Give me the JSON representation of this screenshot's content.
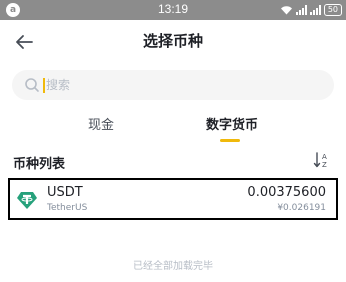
{
  "status_bar": {
    "time": "13:19",
    "notification_badge": "a",
    "battery": "50"
  },
  "header": {
    "title": "选择币种"
  },
  "search": {
    "placeholder": "搜索",
    "value": ""
  },
  "tabs": [
    {
      "label": "现金",
      "active": false
    },
    {
      "label": "数字货币",
      "active": true
    }
  ],
  "section": {
    "title": "币种列表"
  },
  "coins": [
    {
      "symbol": "USDT",
      "name": "TetherUS",
      "amount": "0.00375600",
      "fiat_value": "¥0.026191"
    }
  ],
  "footer_note": "已经全部加载完毕",
  "colors": {
    "accent": "#f0b90b",
    "tether": "#26a17b",
    "status_bar": "#8c8c8c",
    "muted_text": "#848e9c"
  }
}
